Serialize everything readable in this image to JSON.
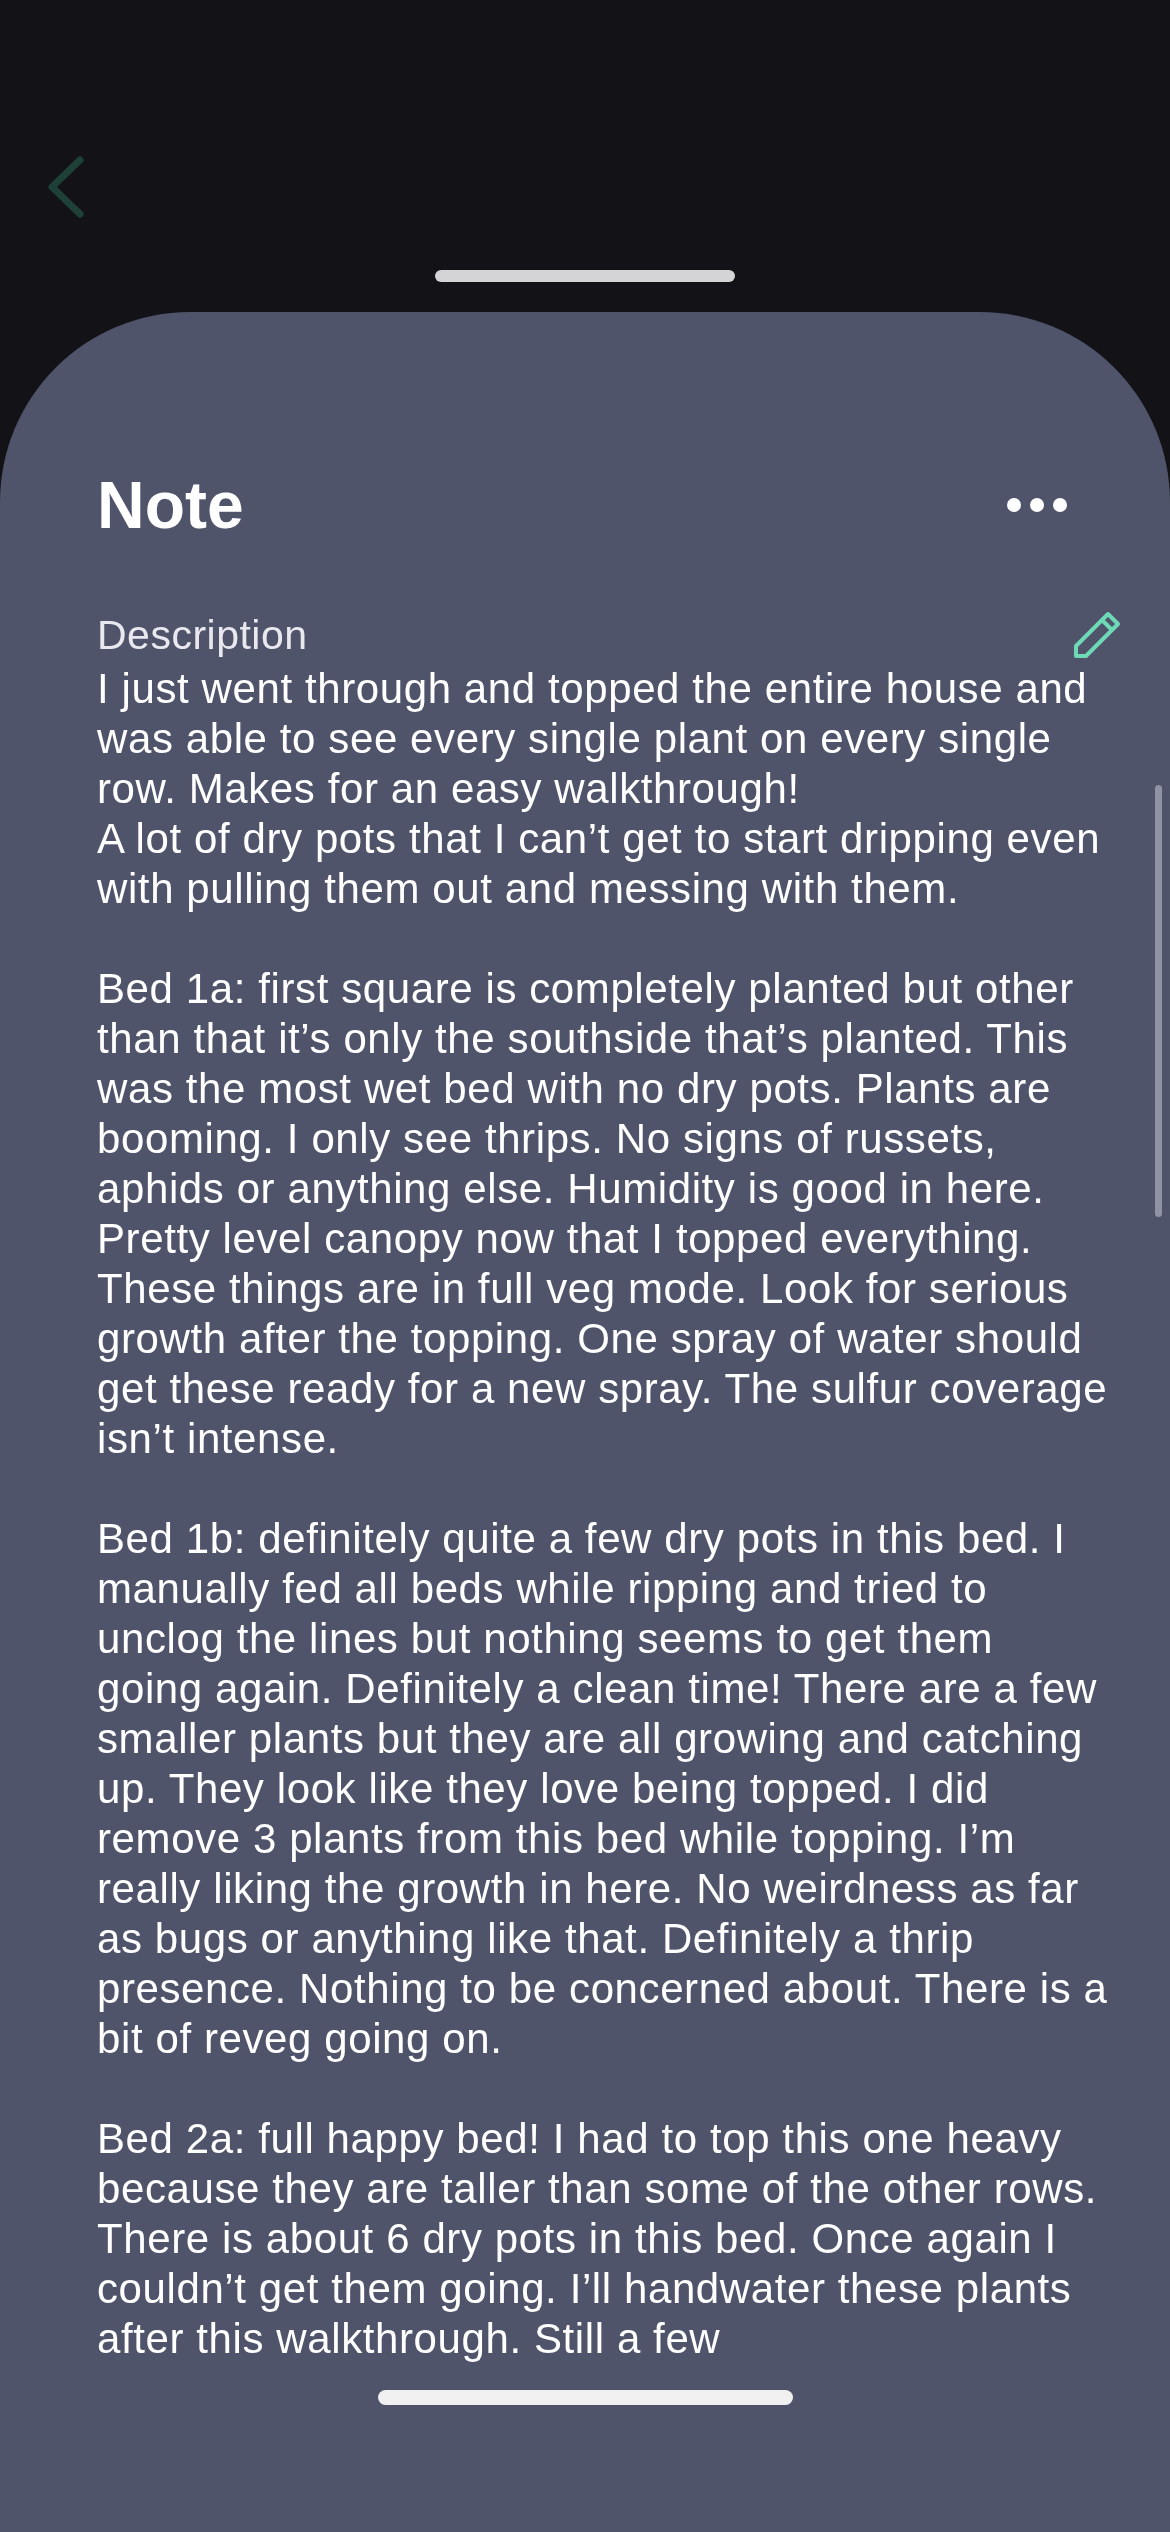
{
  "note_sheet": {
    "title": "Note",
    "description_label": "Description",
    "paragraphs": [
      "I just went through and topped the entire house and was able to see every single plant on every single row. Makes for an easy walkthrough!\nA lot of dry pots that I can’t get to start dripping even with pulling them out and messing with them.",
      "Bed 1a: first square is completely planted but other than that it’s only the southside that’s planted. This was the most wet bed with no dry pots. Plants are booming. I only see thrips. No signs of russets, aphids or anything else. Humidity is good in here. Pretty level canopy now that I topped everything. These things are in full veg mode. Look for serious growth after the topping. One spray of water should get these ready for a new spray. The sulfur coverage isn’t intense.",
      "Bed 1b: definitely quite a few dry pots in this bed. I manually fed all beds while ripping and tried to unclog the lines but nothing seems to get them going again. Definitely a clean time! There are a few smaller plants but they are all growing and catching up. They look like they love being topped. I did remove 3 plants from this bed while topping. I’m really liking the growth in here. No weirdness as far as bugs or anything like that. Definitely a thrip presence. Nothing to be concerned about. There is a bit of reveg going on.",
      "Bed 2a: full happy bed! I had to top this one heavy because they are taller than some of the other rows. There is about 6 dry pots in this bed. Once again I couldn’t get them going. I’ll handwater these plants after this walkthrough. Still a few"
    ]
  }
}
